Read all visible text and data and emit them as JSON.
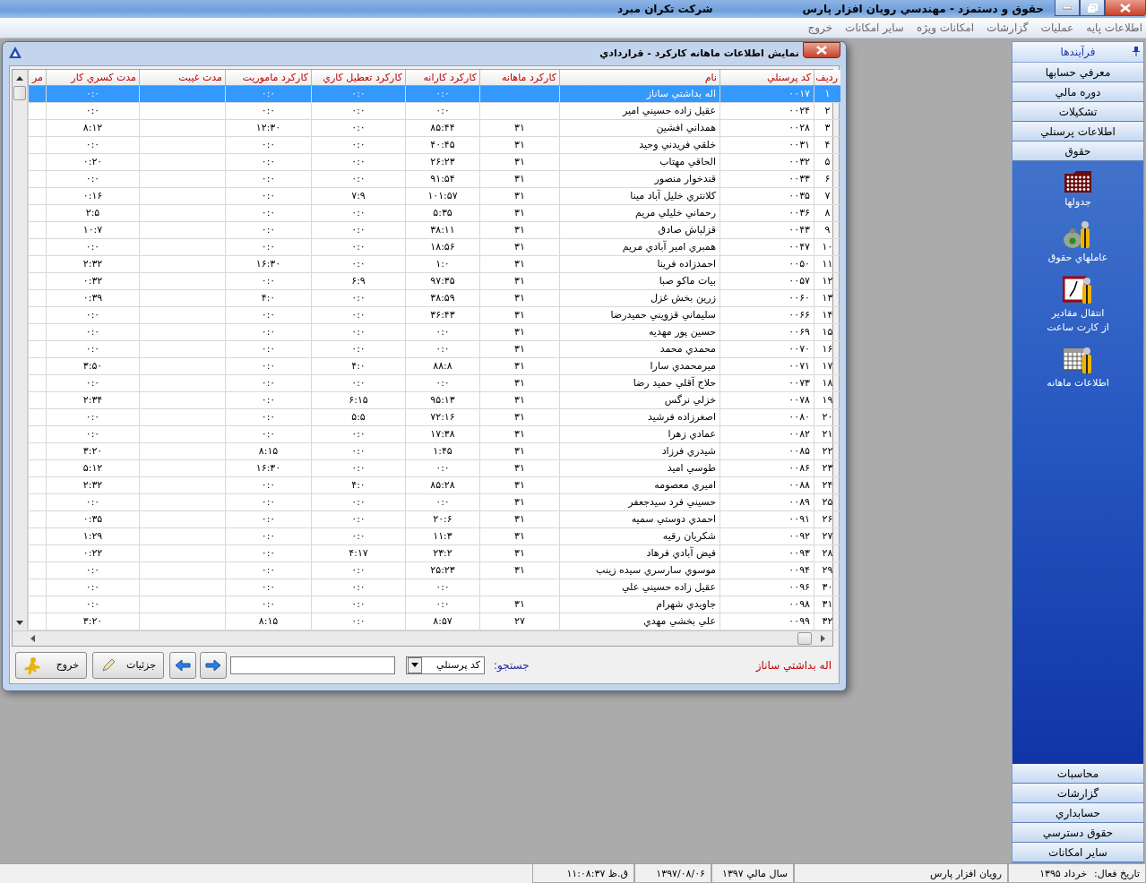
{
  "window": {
    "title": "حقوق و دستمزد - مهندسي رويان افزار پارس",
    "company": "شرکت تکران مبرد"
  },
  "menu": [
    "اطلاعات پايه",
    "عمليات",
    "گزارشات",
    "امکانات ويژه",
    "ساير امکانات",
    "خروج"
  ],
  "dialog": {
    "title": "نمايش اطلاعات ماهانه کارکرد - قراردادي",
    "table": {
      "columns": [
        "رديف",
        "کد پرسنلي",
        "نام",
        "کارکرد ماهانه",
        "کارکرد کارانه",
        "کارکرد تعطيل کاري",
        "کارکرد ماموريت",
        "مدت غيبت",
        "مدت کسري کار",
        "مر"
      ],
      "rows": [
        {
          "selected": true,
          "cells": [
            "۱",
            "۰۰۱۷",
            "اله بداشتي ساناز",
            null,
            "۰:۰",
            "۰:۰",
            "۰:۰",
            null,
            "۰:۰",
            null
          ]
        },
        {
          "selected": false,
          "cells": [
            "۲",
            "۰۰۲۴",
            "عقيل زاده حسيني امير",
            null,
            "۰:۰",
            "۰:۰",
            "۰:۰",
            null,
            "۰:۰",
            null
          ]
        },
        {
          "selected": false,
          "cells": [
            "۳",
            "۰۰۲۸",
            "همداني افشين",
            "۳۱",
            "۸۵:۴۴",
            "۰:۰",
            "۱۲:۳۰",
            null,
            "۸:۱۲",
            null
          ]
        },
        {
          "selected": false,
          "cells": [
            "۴",
            "۰۰۳۱",
            "خلقي فريدني وحيد",
            "۳۱",
            "۴۰:۴۵",
            "۰:۰",
            "۰:۰",
            null,
            "۰:۰",
            null
          ]
        },
        {
          "selected": false,
          "cells": [
            "۵",
            "۰۰۳۲",
            "الحاقي مهتاب",
            "۳۱",
            "۲۶:۲۳",
            "۰:۰",
            "۰:۰",
            null,
            "۰:۲۰",
            null
          ]
        },
        {
          "selected": false,
          "cells": [
            "۶",
            "۰۰۳۳",
            "قندخوار منصور",
            "۳۱",
            "۹۱:۵۴",
            "۰:۰",
            "۰:۰",
            null,
            "۰:۰",
            null
          ]
        },
        {
          "selected": false,
          "cells": [
            "۷",
            "۰۰۳۵",
            "کلانتري خليل آباد مينا",
            "۳۱",
            "۱۰۱:۵۷",
            "۷:۹",
            "۰:۰",
            null,
            "۰:۱۶",
            null
          ]
        },
        {
          "selected": false,
          "cells": [
            "۸",
            "۰۰۳۶",
            "رحماني خليلي مريم",
            "۳۱",
            "۵:۳۵",
            "۰:۰",
            "۰:۰",
            null,
            "۲:۵",
            null
          ]
        },
        {
          "selected": false,
          "cells": [
            "۹",
            "۰۰۴۳",
            "قزلباش صادق",
            "۳۱",
            "۳۸:۱۱",
            "۰:۰",
            "۰:۰",
            null,
            "۱۰:۷",
            null
          ]
        },
        {
          "selected": false,
          "cells": [
            "۱۰",
            "۰۰۴۷",
            "همبري امير آبادي مريم",
            "۳۱",
            "۱۸:۵۶",
            "۰:۰",
            "۰:۰",
            null,
            "۰:۰",
            null
          ]
        },
        {
          "selected": false,
          "cells": [
            "۱۱",
            "۰۰۵۰",
            "احمدزاده فرينا",
            "۳۱",
            "۱:۰",
            "۰:۰",
            "۱۶:۳۰",
            null,
            "۲:۳۲",
            null
          ]
        },
        {
          "selected": false,
          "cells": [
            "۱۲",
            "۰۰۵۷",
            "بيات ماکو صبا",
            "۳۱",
            "۹۷:۳۵",
            "۶:۹",
            "۰:۰",
            null,
            "۰:۳۲",
            null
          ]
        },
        {
          "selected": false,
          "cells": [
            "۱۳",
            "۰۰۶۰",
            "زرين بخش غزل",
            "۳۱",
            "۳۸:۵۹",
            "۰:۰",
            "۴:۰",
            null,
            "۰:۳۹",
            null
          ]
        },
        {
          "selected": false,
          "cells": [
            "۱۴",
            "۰۰۶۶",
            "سليماني قزويني حميدرضا",
            "۳۱",
            "۳۶:۴۳",
            "۰:۰",
            "۰:۰",
            null,
            "۰:۰",
            null
          ]
        },
        {
          "selected": false,
          "cells": [
            "۱۵",
            "۰۰۶۹",
            "حسين پور مهديه",
            "۳۱",
            "۰:۰",
            "۰:۰",
            "۰:۰",
            null,
            "۰:۰",
            null
          ]
        },
        {
          "selected": false,
          "cells": [
            "۱۶",
            "۰۰۷۰",
            "محمدي محمد",
            "۳۱",
            "۰:۰",
            "۰:۰",
            "۰:۰",
            null,
            "۰:۰",
            null
          ]
        },
        {
          "selected": false,
          "cells": [
            "۱۷",
            "۰۰۷۱",
            "ميرمحمدي سارا",
            "۳۱",
            "۸۸:۸",
            "۴:۰",
            "۰:۰",
            null,
            "۳:۵۰",
            null
          ]
        },
        {
          "selected": false,
          "cells": [
            "۱۸",
            "۰۰۷۳",
            "حلاج آقلي حميد رضا",
            "۳۱",
            "۰:۰",
            "۰:۰",
            "۰:۰",
            null,
            "۰:۰",
            null
          ]
        },
        {
          "selected": false,
          "cells": [
            "۱۹",
            "۰۰۷۸",
            "خزلي نرگس",
            "۳۱",
            "۹۵:۱۳",
            "۶:۱۵",
            "۰:۰",
            null,
            "۲:۳۴",
            null
          ]
        },
        {
          "selected": false,
          "cells": [
            "۲۰",
            "۰۰۸۰",
            "اصغرزاده فرشيد",
            "۳۱",
            "۷۲:۱۶",
            "۵:۵",
            "۰:۰",
            null,
            "۰:۰",
            null
          ]
        },
        {
          "selected": false,
          "cells": [
            "۲۱",
            "۰۰۸۲",
            "عمادي زهرا",
            "۳۱",
            "۱۷:۳۸",
            "۰:۰",
            "۰:۰",
            null,
            "۰:۰",
            null
          ]
        },
        {
          "selected": false,
          "cells": [
            "۲۲",
            "۰۰۸۵",
            "شيدري فرزاد",
            "۳۱",
            "۱:۴۵",
            "۰:۰",
            "۸:۱۵",
            null,
            "۳:۲۰",
            null
          ]
        },
        {
          "selected": false,
          "cells": [
            "۲۳",
            "۰۰۸۶",
            "طوسي اميد",
            "۳۱",
            "۰:۰",
            "۰:۰",
            "۱۶:۳۰",
            null,
            "۵:۱۲",
            null
          ]
        },
        {
          "selected": false,
          "cells": [
            "۲۴",
            "۰۰۸۸",
            "اميري معصومه",
            "۳۱",
            "۸۵:۲۸",
            "۴:۰",
            "۰:۰",
            null,
            "۲:۳۲",
            null
          ]
        },
        {
          "selected": false,
          "cells": [
            "۲۵",
            "۰۰۸۹",
            "حسيني فرد سيدجعفر",
            "۳۱",
            "۰:۰",
            "۰:۰",
            "۰:۰",
            null,
            "۰:۰",
            null
          ]
        },
        {
          "selected": false,
          "cells": [
            "۲۶",
            "۰۰۹۱",
            "احمدي دوستي سميه",
            "۳۱",
            "۲۰:۶",
            "۰:۰",
            "۰:۰",
            null,
            "۰:۳۵",
            null
          ]
        },
        {
          "selected": false,
          "cells": [
            "۲۷",
            "۰۰۹۲",
            "شکريان رقيه",
            "۳۱",
            "۱۱:۳",
            "۰:۰",
            "۰:۰",
            null,
            "۱:۲۹",
            null
          ]
        },
        {
          "selected": false,
          "cells": [
            "۲۸",
            "۰۰۹۳",
            "فيض آبادي فرهاد",
            "۳۱",
            "۲۳:۲",
            "۴:۱۷",
            "۰:۰",
            null,
            "۰:۲۲",
            null
          ]
        },
        {
          "selected": false,
          "cells": [
            "۲۹",
            "۰۰۹۴",
            "موسوي سارسري سيده زينب",
            "۳۱",
            "۲۵:۲۳",
            "۰:۰",
            "۰:۰",
            null,
            "۰:۰",
            null
          ]
        },
        {
          "selected": false,
          "cells": [
            "۳۰",
            "۰۰۹۶",
            "عقيل زاده حسيني علي",
            null,
            "۰:۰",
            "۰:۰",
            "۰:۰",
            null,
            "۰:۰",
            null
          ]
        },
        {
          "selected": false,
          "cells": [
            "۳۱",
            "۰۰۹۸",
            "جاويدي شهرام",
            "۳۱",
            "۰:۰",
            "۰:۰",
            "۰:۰",
            null,
            "۰:۰",
            null
          ]
        },
        {
          "selected": false,
          "cells": [
            "۳۲",
            "۰۰۹۹",
            "علي بخشي مهدي",
            "۲۷",
            "۸:۵۷",
            "۰:۰",
            "۸:۱۵",
            null,
            "۳:۲۰",
            null
          ]
        }
      ]
    },
    "current_name": "اله بداشتي ساناز",
    "search": {
      "label": "جستجو:",
      "field": "کد پرسنلي"
    },
    "buttons": [
      {
        "label": "جزئيات",
        "kind": "details"
      },
      {
        "label": "خروج",
        "kind": "exit"
      }
    ]
  },
  "sidebar": {
    "title": "فرآيندها",
    "sections": [
      "معرفي حسابها",
      "دوره مالي",
      "تشکيلات",
      "اطلاعات پرسنلي",
      "حقوق"
    ],
    "items": [
      {
        "kind": "tables",
        "lines": [
          "جدولها"
        ]
      },
      {
        "kind": "factors",
        "lines": [
          "عاملهاي حقوق"
        ]
      },
      {
        "kind": "clock",
        "lines": [
          "انتقال مقادير",
          "از کارت ساعت"
        ]
      },
      {
        "kind": "monthly",
        "lines": [
          "اطلاعات ماهانه"
        ]
      }
    ],
    "bottom_sections": [
      "محاسبات",
      "گزارشات",
      "حسابداري",
      "حقوق دسترسي",
      "ساير امکانات"
    ]
  },
  "status_bar": {
    "active_date_label": "تاريخ فعال:",
    "active_date": "خرداد ۱۳۹۵",
    "company": "رويان افزار پارس",
    "fiscal_year": "سال مالي ۱۳۹۷",
    "date": "۱۳۹۷/۰۸/۰۶",
    "time": "ق.ظ ۱۱:۰۸:۳۷"
  }
}
